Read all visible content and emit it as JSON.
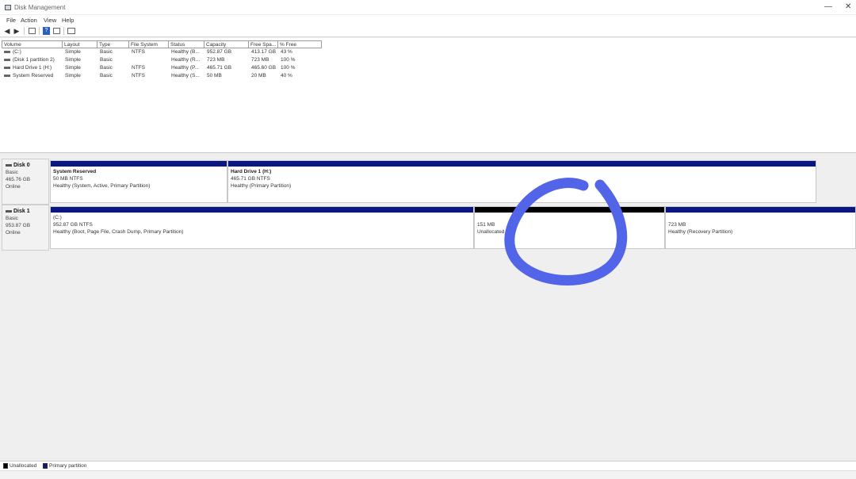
{
  "window": {
    "title": "Disk Management",
    "minimize_glyph": "—",
    "close_glyph": "✕"
  },
  "menu": [
    "File",
    "Action",
    "View",
    "Help"
  ],
  "toolbar": {
    "icons": [
      "back-arrow-icon",
      "forward-arrow-icon",
      "properties-icon",
      "help-icon",
      "console-icon"
    ]
  },
  "volume_list": {
    "columns": [
      "Volume",
      "Layout",
      "Type",
      "File System",
      "Status",
      "Capacity",
      "Free Spa...",
      "% Free"
    ],
    "rows": [
      [
        "(C:)",
        "Simple",
        "Basic",
        "NTFS",
        "Healthy (B...",
        "952.87 GB",
        "413.17 GB",
        "43 %"
      ],
      [
        "(Disk 1 partition 2)",
        "Simple",
        "Basic",
        "",
        "Healthy (R...",
        "723 MB",
        "723 MB",
        "100 %"
      ],
      [
        "Hard Drive 1 (H:)",
        "Simple",
        "Basic",
        "NTFS",
        "Healthy (P...",
        "465.71 GB",
        "465.60 GB",
        "100 %"
      ],
      [
        "System Reserved",
        "Simple",
        "Basic",
        "NTFS",
        "Healthy (S...",
        "50 MB",
        "20 MB",
        "40 %"
      ]
    ]
  },
  "disks": [
    {
      "name": "Disk 0",
      "type": "Basic",
      "size": "465.76 GB",
      "status": "Online",
      "partitions": [
        {
          "name": "System Reserved",
          "size": "50 MB NTFS",
          "status": "Healthy (System, Active, Primary Partition)",
          "kind": "primary"
        },
        {
          "name": "Hard Drive 1 (H:)",
          "size": "465.71 GB NTFS",
          "status": "Healthy (Primary Partition)",
          "kind": "primary"
        }
      ]
    },
    {
      "name": "Disk 1",
      "type": "Basic",
      "size": "953.87 GB",
      "status": "Online",
      "partitions": [
        {
          "name": "(C:)",
          "size": "952.87 GB NTFS",
          "status": "Healthy (Boot, Page File, Crash Dump, Primary Partition)",
          "kind": "primary"
        },
        {
          "name": "",
          "size": "151 MB",
          "status": "Unallocated",
          "kind": "unallocated"
        },
        {
          "name": "",
          "size": "723 MB",
          "status": "Healthy (Recovery Partition)",
          "kind": "primary"
        }
      ]
    }
  ],
  "legend": [
    {
      "label": "Unallocated",
      "color": "#000000"
    },
    {
      "label": "Primary partition",
      "color": "#0b1780"
    }
  ],
  "annotation": {
    "color": "#5264e8",
    "shape": "hand-drawn circle"
  }
}
